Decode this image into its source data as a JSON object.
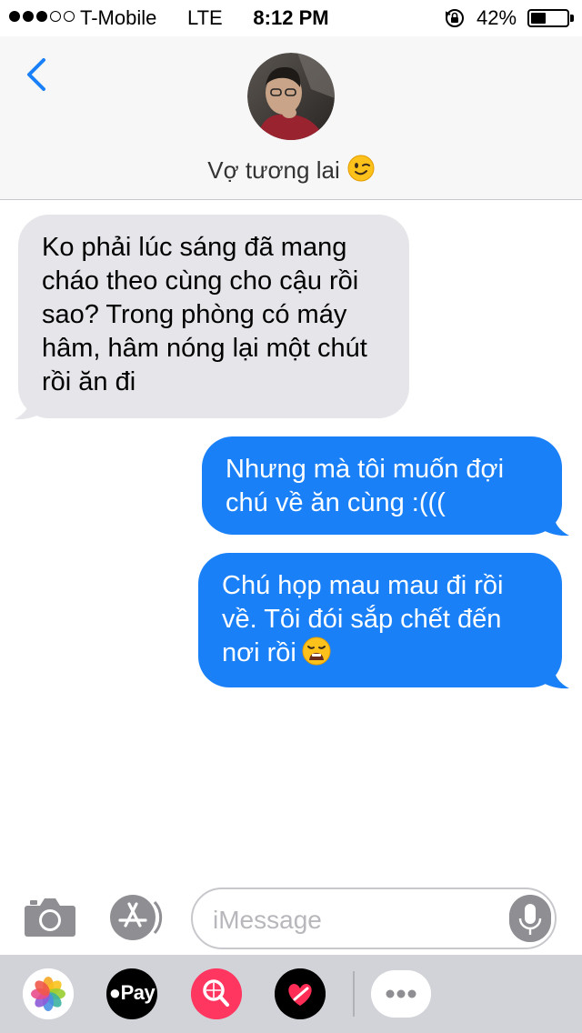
{
  "status_bar": {
    "carrier": "T-Mobile",
    "network": "LTE",
    "time": "8:12 PM",
    "battery_percent": "42%",
    "battery_level": 0.42,
    "signal_bars_filled": 3,
    "signal_bars_total": 5
  },
  "header": {
    "contact_name": "Vợ tương lai",
    "contact_emoji_icon": "winking-face-emoji"
  },
  "messages": [
    {
      "direction": "incoming",
      "text": "Ko phải lúc sáng đã mang cháo theo cùng cho cậu rồi sao? Trong phòng có máy hâm, hâm nóng lại một chút rồi ăn đi"
    },
    {
      "direction": "outgoing",
      "text": "Nhưng mà tôi muốn đợi chú về ăn cùng :((("
    },
    {
      "direction": "outgoing",
      "text": "Chú họp mau mau đi rồi về. Tôi đói sắp chết đến nơi rồi",
      "emoji_icon": "weary-face-emoji"
    }
  ],
  "input": {
    "placeholder": "iMessage"
  },
  "app_drawer": {
    "items": [
      "photos-app-icon",
      "apple-pay-app-icon",
      "search-images-app-icon",
      "digital-touch-app-icon",
      "more-apps-icon"
    ],
    "apple_pay_label": "Pay"
  },
  "colors": {
    "accent": "#1a80f8",
    "incoming_bubble": "#e5e5ea",
    "header_bg": "#f7f7f7",
    "drawer_bg": "#d1d3d8"
  }
}
